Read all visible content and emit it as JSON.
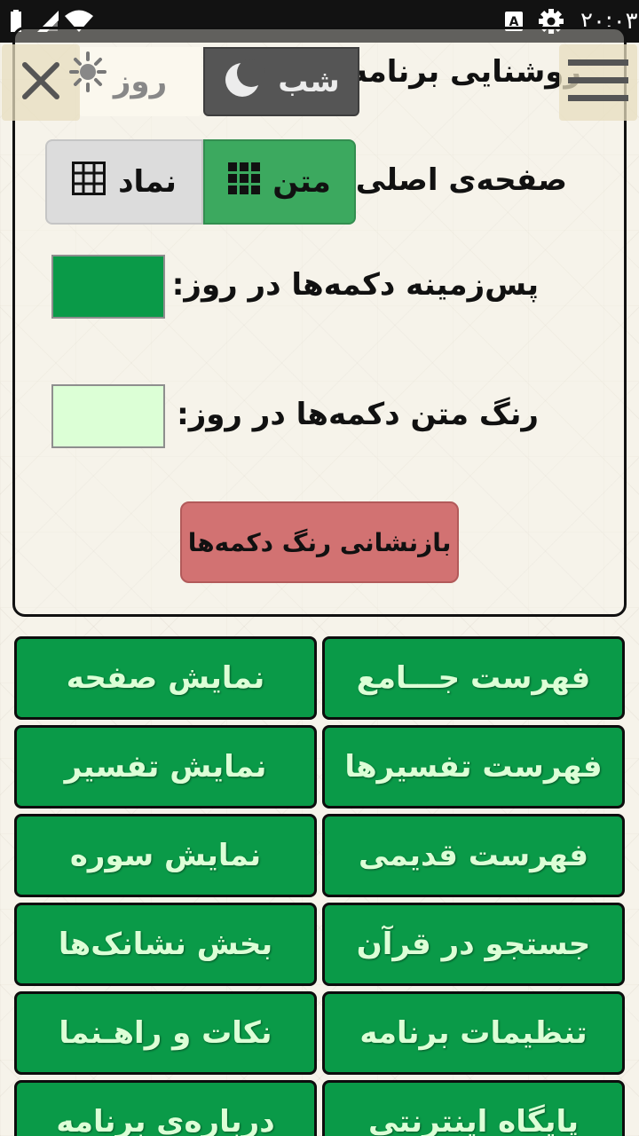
{
  "status_bar": {
    "time": "۲۰:۰۳",
    "icons": [
      "battery-icon",
      "signal-icon",
      "wifi-icon",
      "notification-icon",
      "gear-icon"
    ]
  },
  "settings": {
    "brightness_label": "روشنایی برنامه:",
    "night_label": "شب",
    "day_label": "روز",
    "home_label": "صفحه‌ی اصلی:",
    "text_option": "متن",
    "symbol_option": "نماد",
    "bg_label": "پس‌زمینه دکمه‌ها در روز:",
    "bg_color": "#0a9a48",
    "text_color_label": "رنگ متن دکمه‌ها در روز:",
    "text_color": "#dcffd6",
    "reset_label": "بازنشانی رنگ دکمه‌ها",
    "selected_brightness": "شب",
    "selected_home": "متن"
  },
  "menu": {
    "items": [
      "فهرست جـــامع",
      "نمایش صفحه",
      "فهرست تفسیرها",
      "نمایش تفسیر",
      "فهرست قدیمی",
      "نمایش سوره",
      "جستجو در قرآن",
      "بخش نشانک‌ها",
      "تنظیمات برنامه",
      "نکات و راهـنما",
      "پایگاه اینترنتی",
      "درباره‌ی برنامه"
    ]
  }
}
